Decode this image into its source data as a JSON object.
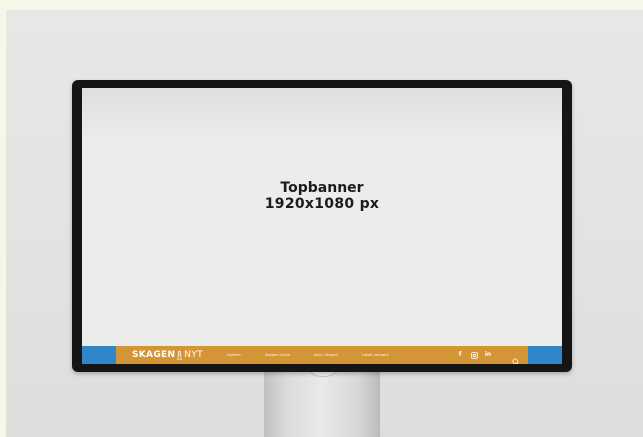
{
  "placeholder": {
    "line1": "Topbanner",
    "line2": "1920x1080 px"
  },
  "footer": {
    "logo_left": "SKAGEN",
    "logo_right": "NYT",
    "nav": [
      {
        "label": "Agtelier"
      },
      {
        "label": "Skagen Guide"
      },
      {
        "label": "Jobs i Skagen"
      },
      {
        "label": "Lokalt netværk"
      }
    ],
    "social_icons": [
      "facebook-icon",
      "instagram-icon",
      "linkedin-icon"
    ],
    "social_glyphs": {
      "facebook": "f",
      "linkedin": "in"
    }
  },
  "colors": {
    "bar": "#d39536",
    "blue": "#2f86c9",
    "bezel": "#151515",
    "screen": "#ececea"
  }
}
